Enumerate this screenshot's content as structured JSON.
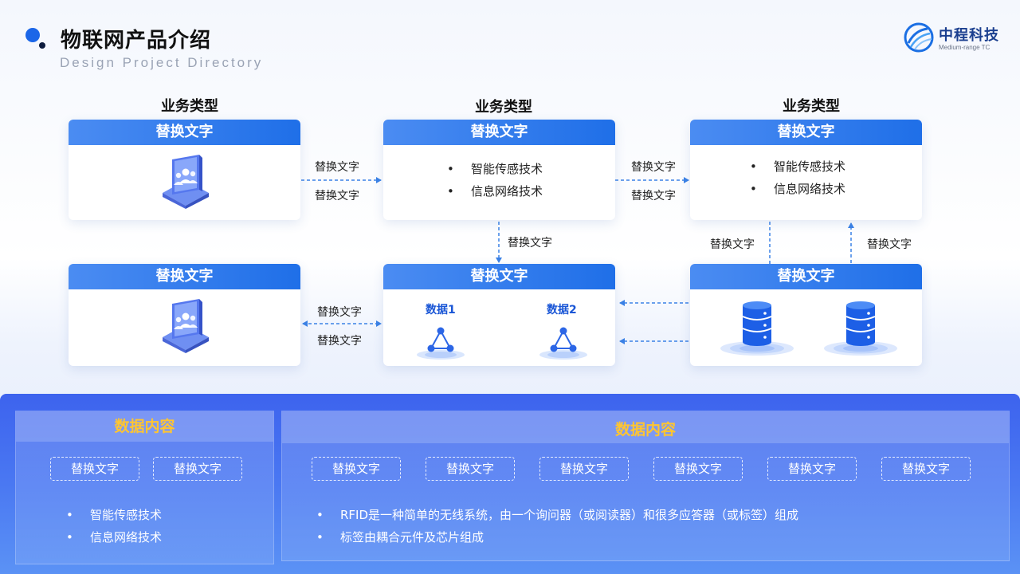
{
  "header": {
    "title": "物联网产品介绍",
    "subtitle": "Design Project Directory"
  },
  "logo": {
    "name": "中程科技",
    "sub": "Medium-range TC"
  },
  "columns": [
    "业务类型",
    "业务类型",
    "业务类型"
  ],
  "cards": {
    "top_left": {
      "title": "替换文字",
      "icon": "users-screen-icon"
    },
    "top_middle": {
      "title": "替换文字",
      "items": [
        "智能传感技术",
        "信息网络技术"
      ]
    },
    "top_right": {
      "title": "替换文字",
      "items": [
        "智能传感技术",
        "信息网络技术"
      ]
    },
    "bottom_left": {
      "title": "替换文字",
      "icon": "users-screen-icon"
    },
    "bottom_middle": {
      "title": "替换文字",
      "data": [
        "数据1",
        "数据2"
      ],
      "icon": "network-node-icon"
    },
    "bottom_right": {
      "title": "替换文字",
      "icon": "database-icon"
    }
  },
  "connectors": {
    "top_left_to_middle": [
      "替换文字",
      "替换文字"
    ],
    "top_middle_to_right": [
      "替换文字",
      "替换文字"
    ],
    "middle_down": "替换文字",
    "right_left": "替换文字",
    "right_right": "替换文字",
    "bottom_left_middle": [
      "替换文字",
      "替换文字"
    ]
  },
  "bottom": {
    "left_panel": {
      "title": "数据内容",
      "tags": [
        "替换文字",
        "替换文字"
      ],
      "items": [
        "智能传感技术",
        "信息网络技术"
      ]
    },
    "right_panel": {
      "title": "数据内容",
      "tags": [
        "替换文字",
        "替换文字",
        "替换文字",
        "替换文字",
        "替换文字",
        "替换文字"
      ],
      "items": [
        "RFID是一种简单的无线系统，由一个询问器（或阅读器）和很多应答器（或标签）组成",
        "标签由耦合元件及芯片组成"
      ]
    }
  },
  "colors": {
    "accent": "#1f6fe8",
    "panel": "#4a78f2",
    "highlight": "#ffc531",
    "connector": "#3b82e6"
  }
}
